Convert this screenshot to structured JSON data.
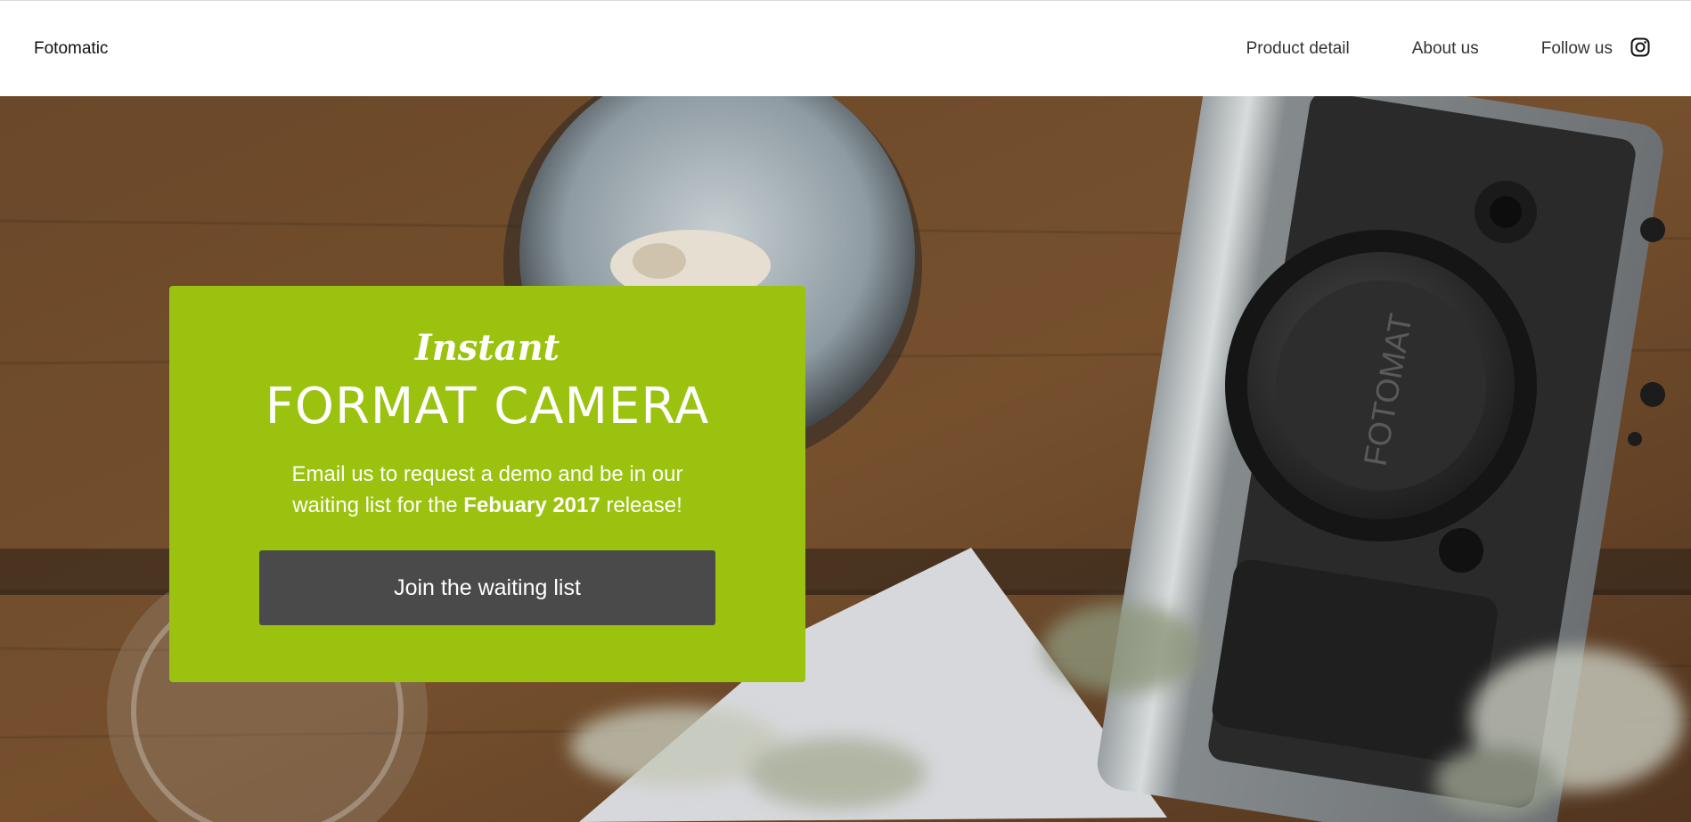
{
  "navbar": {
    "brand": "Fotomatic",
    "links": [
      {
        "label": "Product detail"
      },
      {
        "label": "About us"
      },
      {
        "label": "Follow us"
      }
    ],
    "icon": "instagram-icon"
  },
  "hero": {
    "card": {
      "script_title": "Instant",
      "headline": "FORMAT CAMERA",
      "desc_before": "Email us to request a demo and be in our waiting list for the ",
      "desc_bold": "Febuary 2017",
      "desc_after": " release!",
      "cta_label": "Join the waiting list"
    },
    "camera_cap_text": "FOTOMAT",
    "colors": {
      "card_bg": "#9bc20e",
      "button_bg": "#4a4a4a",
      "wood": "#6e4a2a"
    }
  }
}
